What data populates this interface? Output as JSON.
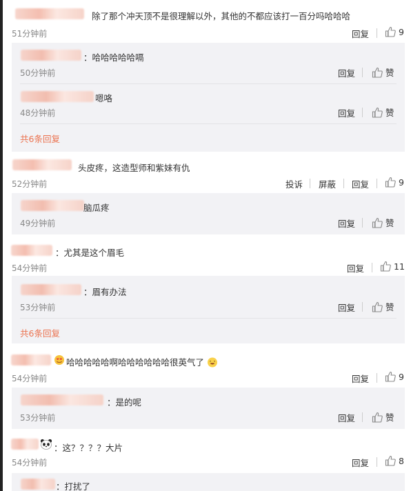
{
  "icons": {
    "like": "thumbs-up-icon",
    "panda": "panda-emoji-icon",
    "face": "laughing-face-emoji-icon",
    "heart_eyes": "heart-eyes-emoji-icon"
  },
  "colors": {
    "link": "#eb7350",
    "subbg": "#f2f2f5",
    "muted": "#888888"
  },
  "actions": {
    "reply": "回复",
    "like": "赞",
    "report": "投诉",
    "block": "屏蔽"
  },
  "comments": [
    {
      "text": "除了那个冲天顶不是很理解以外，其他的不都应该打一百分吗哈哈哈",
      "time": "51分钟前",
      "likes": "9",
      "replies": [
        {
          "text": "：哈哈哈哈哈嗝",
          "time": "50分钟前"
        },
        {
          "text": "嗯咯",
          "time": "48分钟前"
        }
      ],
      "more": "共6条回复"
    },
    {
      "text": "头皮疼，这造型师和紫妹有仇",
      "time": "52分钟前",
      "likes": "9",
      "replies": [
        {
          "text": "脑瓜疼",
          "time": "49分钟前"
        }
      ]
    },
    {
      "text": "：尤其是这个眉毛",
      "time": "54分钟前",
      "likes": "11",
      "replies": [
        {
          "text": "：眉有办法",
          "time": "53分钟前"
        }
      ],
      "more": "共6条回复"
    },
    {
      "text": "哈哈哈哈哈啊哈哈哈哈哈哈很英气了",
      "time": "54分钟前",
      "likes": "9",
      "replies": [
        {
          "text": "：是的呢",
          "time": "53分钟前"
        }
      ]
    },
    {
      "text": "：这？？？？大片",
      "time": "54分钟前",
      "likes": "8",
      "replies": [
        {
          "text": "：打扰了"
        }
      ]
    }
  ]
}
